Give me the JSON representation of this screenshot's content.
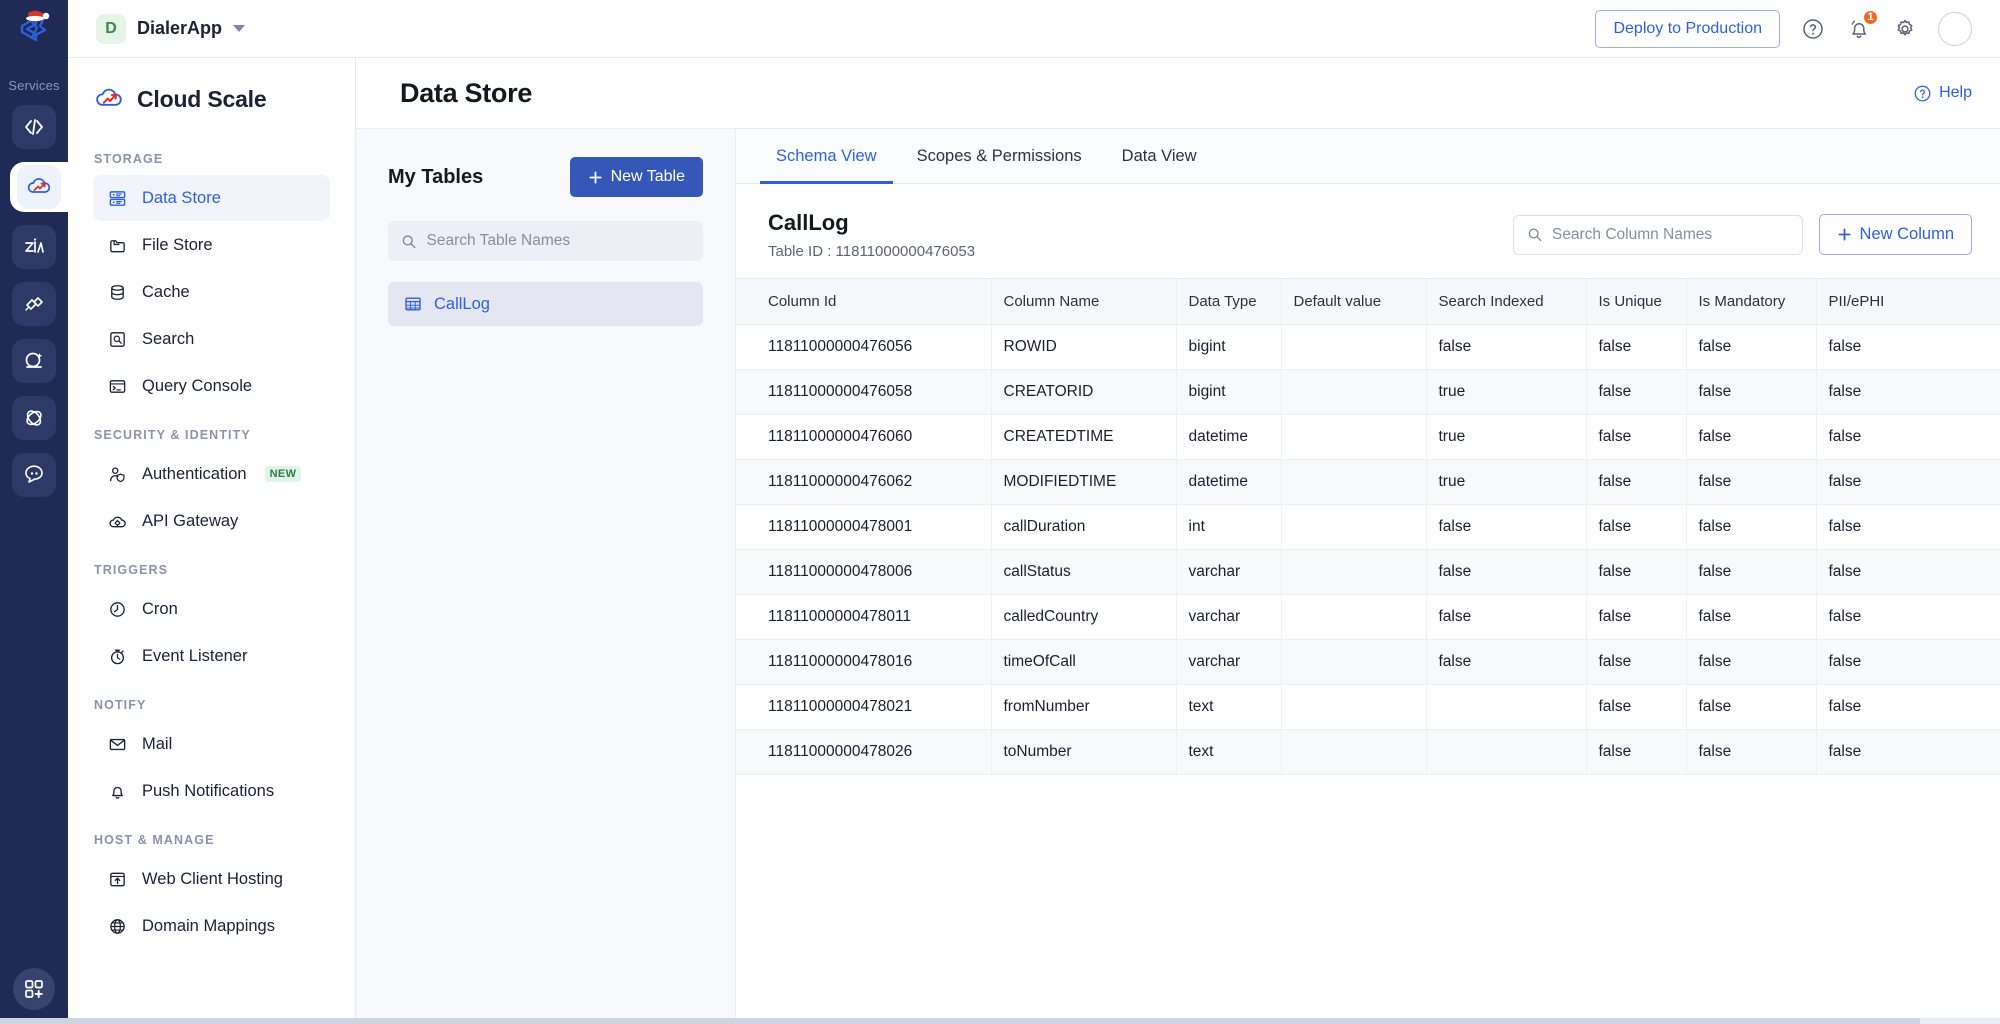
{
  "rail": {
    "services_label": "Services",
    "icons": [
      {
        "name": "code-icon",
        "active": false
      },
      {
        "name": "cloud-scale-icon",
        "active": true
      },
      {
        "name": "zia-icon",
        "active": false
      },
      {
        "name": "link-icon",
        "active": false
      },
      {
        "name": "catalyst-quickml-icon",
        "active": false
      },
      {
        "name": "orbit-icon",
        "active": false
      },
      {
        "name": "chat-icon",
        "active": false
      }
    ],
    "bottom_icon": "apps-add-icon"
  },
  "topbar": {
    "app_initial": "D",
    "app_name": "DialerApp",
    "deploy_label": "Deploy to Production",
    "help_icon": "question-circle-icon",
    "bell_icon": "bell-icon",
    "bell_count": "1",
    "settings_icon": "gear-icon",
    "avatar": "user-avatar"
  },
  "sidebar": {
    "brand": "Cloud Scale",
    "brand_icon": "cloud-scale-logo",
    "sections": [
      {
        "label": "STORAGE",
        "items": [
          {
            "label": "Data Store",
            "icon": "data-store-icon",
            "active": true,
            "badge": ""
          },
          {
            "label": "File Store",
            "icon": "file-store-icon",
            "active": false,
            "badge": ""
          },
          {
            "label": "Cache",
            "icon": "cache-icon",
            "active": false,
            "badge": ""
          },
          {
            "label": "Search",
            "icon": "search-square-icon",
            "active": false,
            "badge": ""
          },
          {
            "label": "Query Console",
            "icon": "query-console-icon",
            "active": false,
            "badge": ""
          }
        ]
      },
      {
        "label": "SECURITY & IDENTITY",
        "items": [
          {
            "label": "Authentication",
            "icon": "authentication-icon",
            "active": false,
            "badge": "NEW"
          },
          {
            "label": "API Gateway",
            "icon": "api-gateway-icon",
            "active": false,
            "badge": ""
          }
        ]
      },
      {
        "label": "TRIGGERS",
        "items": [
          {
            "label": "Cron",
            "icon": "clock-icon",
            "active": false,
            "badge": ""
          },
          {
            "label": "Event Listener",
            "icon": "stopwatch-icon",
            "active": false,
            "badge": ""
          }
        ]
      },
      {
        "label": "NOTIFY",
        "items": [
          {
            "label": "Mail",
            "icon": "mail-icon",
            "active": false,
            "badge": ""
          },
          {
            "label": "Push Notifications",
            "icon": "bell-icon",
            "active": false,
            "badge": ""
          }
        ]
      },
      {
        "label": "HOST & MANAGE",
        "items": [
          {
            "label": "Web Client Hosting",
            "icon": "web-client-hosting-icon",
            "active": false,
            "badge": ""
          },
          {
            "label": "Domain Mappings",
            "icon": "globe-icon",
            "active": false,
            "badge": ""
          }
        ]
      }
    ]
  },
  "page": {
    "title": "Data Store",
    "help_label": "Help",
    "help_icon": "question-circle-icon"
  },
  "tables_pane": {
    "title": "My Tables",
    "new_table_label": "New Table",
    "new_table_icon": "plus-icon",
    "search_placeholder": "Search Table Names",
    "search_value": "",
    "search_icon": "search-icon",
    "items": [
      {
        "label": "CallLog",
        "icon": "table-grid-icon",
        "selected": true
      }
    ]
  },
  "schema": {
    "tabs": [
      {
        "label": "Schema View",
        "active": true
      },
      {
        "label": "Scopes & Permissions",
        "active": false
      },
      {
        "label": "Data View",
        "active": false
      }
    ],
    "table_name": "CallLog",
    "table_id_label": "Table ID : 11811000000476053",
    "column_search_placeholder": "Search Column Names",
    "column_search_value": "",
    "column_search_icon": "search-icon",
    "new_column_label": "New Column",
    "new_column_icon": "plus-icon",
    "columns": [
      "Column Id",
      "Column Name",
      "Data Type",
      "Default value",
      "Search Indexed",
      "Is Unique",
      "Is Mandatory",
      "PII/ePHI"
    ],
    "rows": [
      [
        "11811000000476056",
        "ROWID",
        "bigint",
        "",
        "false",
        "false",
        "false",
        "false"
      ],
      [
        "11811000000476058",
        "CREATORID",
        "bigint",
        "",
        "true",
        "false",
        "false",
        "false"
      ],
      [
        "11811000000476060",
        "CREATEDTIME",
        "datetime",
        "",
        "true",
        "false",
        "false",
        "false"
      ],
      [
        "11811000000476062",
        "MODIFIEDTIME",
        "datetime",
        "",
        "true",
        "false",
        "false",
        "false"
      ],
      [
        "11811000000478001",
        "callDuration",
        "int",
        "",
        "false",
        "false",
        "false",
        "false"
      ],
      [
        "11811000000478006",
        "callStatus",
        "varchar",
        "",
        "false",
        "false",
        "false",
        "false"
      ],
      [
        "11811000000478011",
        "calledCountry",
        "varchar",
        "",
        "false",
        "false",
        "false",
        "false"
      ],
      [
        "11811000000478016",
        "timeOfCall",
        "varchar",
        "",
        "false",
        "false",
        "false",
        "false"
      ],
      [
        "11811000000478021",
        "fromNumber",
        "text",
        "",
        "",
        "false",
        "false",
        "false"
      ],
      [
        "11811000000478026",
        "toNumber",
        "text",
        "",
        "",
        "false",
        "false",
        "false"
      ]
    ]
  },
  "colors": {
    "accent": "#2f5fe0",
    "primary_button": "#3558b8",
    "rail_bg": "#1f2b54",
    "badge_orange": "#f2682a",
    "badge_new_bg": "#e1f5e6"
  }
}
